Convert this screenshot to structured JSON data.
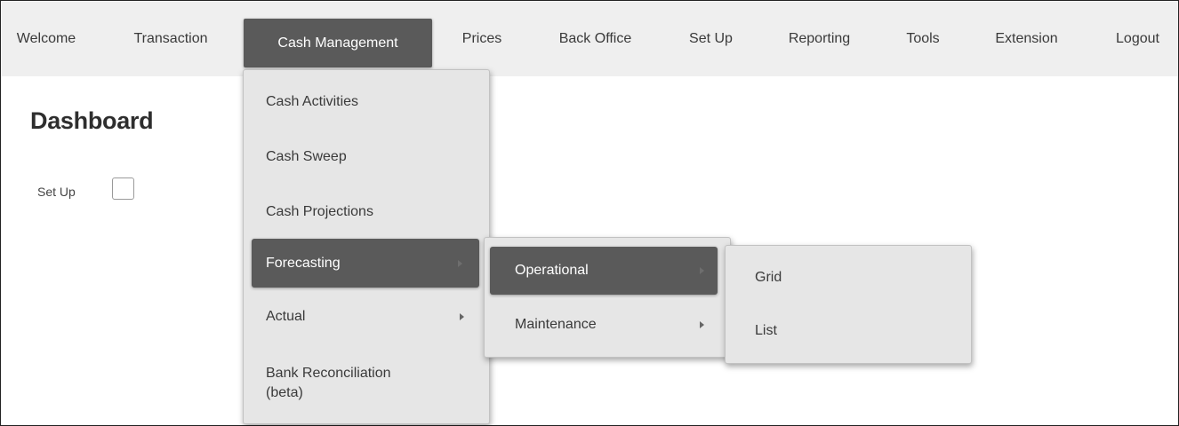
{
  "nav": {
    "items": [
      {
        "label": "Welcome"
      },
      {
        "label": "Transaction"
      },
      {
        "label": "Cash Management"
      },
      {
        "label": "Prices"
      },
      {
        "label": "Back Office"
      },
      {
        "label": "Set Up"
      },
      {
        "label": "Reporting"
      },
      {
        "label": "Tools"
      },
      {
        "label": "Extension"
      },
      {
        "label": "Logout"
      }
    ],
    "active": "Cash Management"
  },
  "page": {
    "title": "Dashboard",
    "setup_label": "Set Up",
    "setup_checked": false
  },
  "cash_menu": {
    "items": [
      {
        "label": "Cash Activities",
        "has_submenu": false
      },
      {
        "label": "Cash Sweep",
        "has_submenu": false
      },
      {
        "label": "Cash Projections",
        "has_submenu": false
      },
      {
        "label": "Forecasting",
        "has_submenu": true,
        "active": true
      },
      {
        "label": "Actual",
        "has_submenu": true
      },
      {
        "label": "Bank Reconciliation",
        "label2": "(beta)",
        "has_submenu": false
      }
    ]
  },
  "forecasting_menu": {
    "items": [
      {
        "label": "Operational",
        "has_submenu": true,
        "active": true
      },
      {
        "label": "Maintenance",
        "has_submenu": true
      }
    ]
  },
  "operational_menu": {
    "items": [
      {
        "label": "Grid"
      },
      {
        "label": "List"
      }
    ]
  },
  "colors": {
    "nav_bg": "#efefef",
    "active_bg": "#5a5a5a",
    "menu_bg": "#e6e6e6"
  }
}
